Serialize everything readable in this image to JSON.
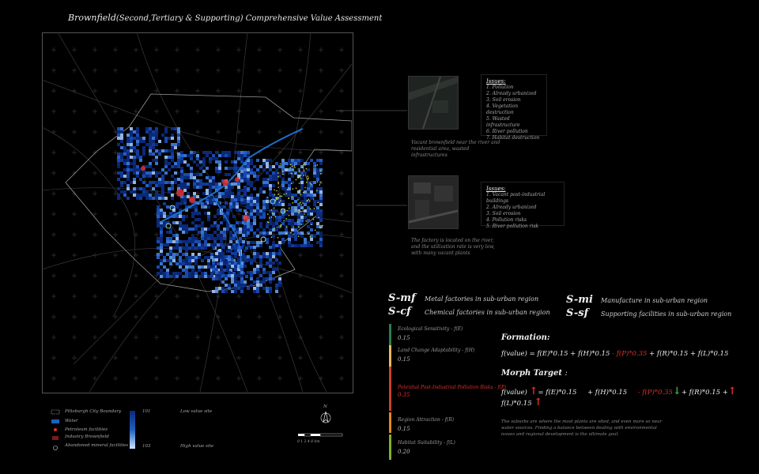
{
  "title": {
    "main": "Brownfield",
    "sub": "(Second,Tertiary & Supporting) Comprehensive Value Assessment"
  },
  "callouts": [
    {
      "heading": "Issues:",
      "items": [
        "1. Pollution",
        "2. Already urbanized",
        "3. Soil erosion",
        "4. Vegetation destruction",
        "5. Wasted infrastructure",
        "6. River pollution",
        "7. Habitat destruction"
      ],
      "caption": "Vacant brownfield near the river and residential area, wasted infrastructures"
    },
    {
      "heading": "Issues:",
      "items": [
        "1. Vacant post-industrial buildings",
        "2. Already urbanized",
        "3. Soil erosion",
        "4. Pollution risks",
        "5. River pollution risk"
      ],
      "caption": "The factory is located on the river, and the utilization rate is very low, with many vacant plants"
    }
  ],
  "categories": [
    {
      "code": "S-mf",
      "desc": "Metal factories in sub-urban region"
    },
    {
      "code": "S-cf",
      "desc": "Chemical factories in sub-urban region"
    },
    {
      "code": "S-mi",
      "desc": "Manufacture in sub-urban region"
    },
    {
      "code": "S-sf",
      "desc": "Supporting facilities in sub-urban region"
    }
  ],
  "factors": [
    {
      "label": "Ecological Sensitivity - f(E)",
      "weight": "0.15",
      "color": "#2e7d4a"
    },
    {
      "label": "Land Change Adaptability - f(H)",
      "weight": "0.15",
      "color": "#e6b96a"
    },
    {
      "label": "Potential Post-Industrial Pollution Risks - f(P)",
      "weight": "0.35",
      "color": "#c8442b"
    },
    {
      "label": "Region Attraction - f(R)",
      "weight": "0.15",
      "color": "#e08a1e"
    },
    {
      "label": "Habitat Suitability - f(L)",
      "weight": "0.20",
      "color": "#7cb32a"
    }
  ],
  "formation": {
    "heading": "Formation:",
    "p1": "f(value) = f(E)*0.15 + f(H)*0.15 ",
    "p2": "- f(P)*0.35",
    "p3": " + f(R)*0.15 + f(L)*0.15"
  },
  "morph": {
    "heading": "Morph Target",
    "colon": ":",
    "l1a": "f(value)",
    "l1b": "= f(E)*0.15",
    "l1c": "+ f(H)*0.15",
    "l1d": "- f(P)*0.35",
    "l1e": "+ f(R)*0.15 +",
    "l2": "f(L)*0.15",
    "note": "The suburbs are where the most plants are sited, and even more so near water sources. Finding a balance between dealing with environmental issues and regional development is the ultimate goal."
  },
  "legend": {
    "items": [
      "Pittsburgh City Boundary",
      "Water",
      "Petroleum facilities",
      "Industry Brownfield",
      "Abandoned mineral facilities"
    ],
    "low": "Low value site",
    "high": "High value site",
    "low_num": "101",
    "high_num": "103",
    "north": "N",
    "scale_ticks": "0  1  2      4           8 km"
  },
  "colors": {
    "value_low": "#0a2a7a",
    "value_high": "#cfe4ff",
    "water": "#1f5fbf",
    "highlight": "#e0302b",
    "vegetation": "#c9d93a"
  }
}
